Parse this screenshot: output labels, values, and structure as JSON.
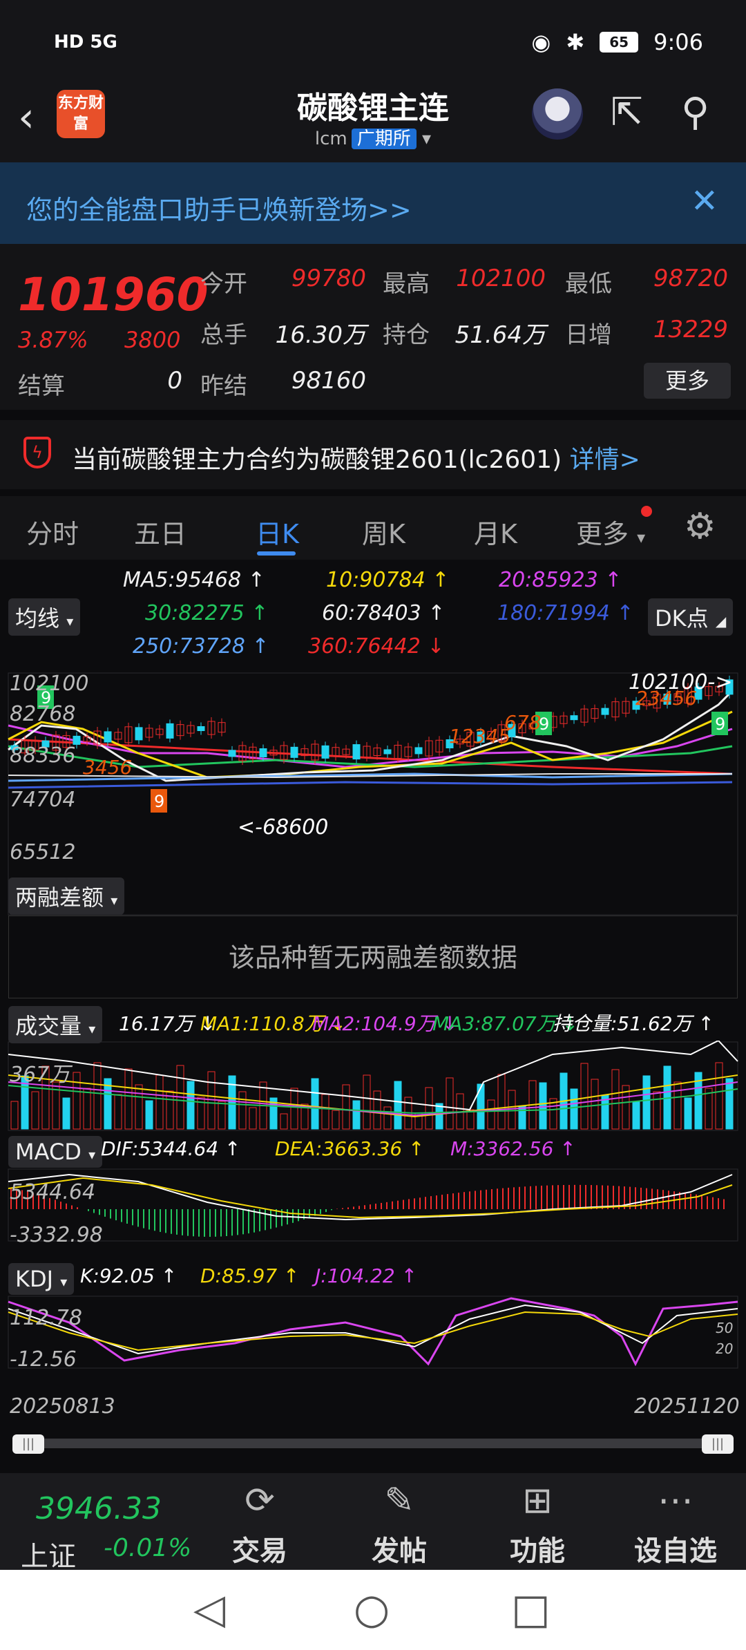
{
  "status": {
    "left_icons": "HD 5G",
    "time": "9:06",
    "battery": "65"
  },
  "header": {
    "title": "碳酸锂主连",
    "code": "lcm",
    "exchange": "广期所",
    "logo_text": "东方财富"
  },
  "banner": {
    "text": "您的全能盘口助手已焕新登场>>"
  },
  "quote": {
    "price": "101960",
    "change_pct": "3.87%",
    "change": "3800",
    "rows": [
      {
        "l1": "今开",
        "v1": "99780",
        "l2": "最高",
        "v2": "102100",
        "l3": "最低",
        "v3": "98720"
      },
      {
        "l1": "总手",
        "v1": "16.30万",
        "l2": "持仓",
        "v2": "51.64万",
        "l3": "日增",
        "v3": "13229"
      }
    ],
    "settle_label": "结算",
    "settle_value": "0",
    "prev_label": "昨结",
    "prev_value": "98160",
    "more_label": "更多"
  },
  "notice": {
    "text": "当前碳酸锂主力合约为碳酸锂2601(lc2601)",
    "link": "详情>"
  },
  "tabs": [
    "分时",
    "五日",
    "日K",
    "周K",
    "月K",
    "更多"
  ],
  "ma": {
    "ma5": "MA5:95468 ↑",
    "ma10": "10:90784 ↑",
    "ma20": "20:85923 ↑",
    "ma30": "30:82275 ↑",
    "ma60": "60:78403 ↑",
    "ma180": "180:71994 ↑",
    "ma250": "250:73728 ↑",
    "ma360": "360:76442 ↓",
    "dropdown": "均线",
    "dk": "DK点"
  },
  "price_axis": {
    "high": "102100",
    "v2": "82768",
    "v3": "88336",
    "v4": "74704",
    "low": "65512",
    "high_mark": "102100->",
    "low_mark": "<-68600"
  },
  "margin": {
    "dropdown": "两融差额",
    "nodata": "该品种暂无两融差额数据"
  },
  "volume": {
    "dropdown": "成交量",
    "vol": "16.17万 ↓",
    "ma1": "MA1:110.8万 ↓",
    "ma2": "MA2:104.9万 ↓",
    "ma3": "MA3:87.07万 ↓",
    "oi": "持仓量:51.62万 ↑",
    "axis": "367万"
  },
  "macd": {
    "dropdown": "MACD",
    "dif": "DIF:5344.64 ↑",
    "dea": "DEA:3663.36 ↑",
    "m": "M:3362.56 ↑",
    "top": "5344.64",
    "bottom": "-3332.98"
  },
  "kdj": {
    "dropdown": "KDJ",
    "k": "K:92.05 ↑",
    "d": "D:85.97 ↑",
    "j": "J:104.22 ↑",
    "top": "112.78",
    "bottom": "-12.56",
    "l50": "50",
    "l20": "20"
  },
  "dates": {
    "start": "20250813",
    "end": "20251120"
  },
  "bottom": {
    "index_value": "3946.33",
    "index_name": "上证",
    "index_change": "-0.01%",
    "items": [
      "交易",
      "发帖",
      "功能",
      "设自选"
    ]
  },
  "colors": {
    "up": "#ef2b2b",
    "down": "#22d3ee",
    "accent": "#3f8cf0"
  }
}
